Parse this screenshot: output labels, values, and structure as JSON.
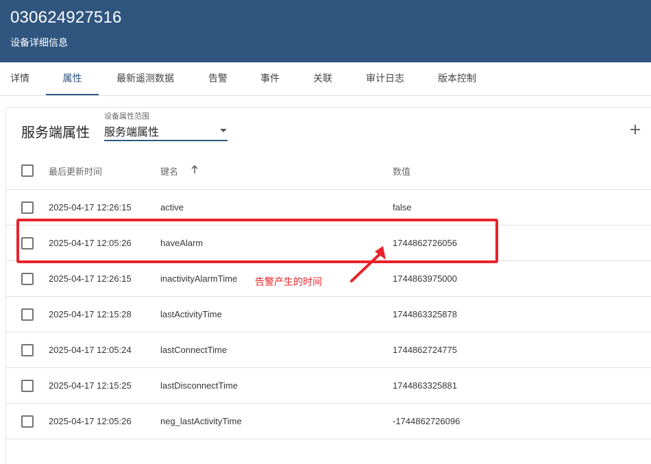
{
  "header": {
    "title": "030624927516",
    "subtitle": "设备详细信息"
  },
  "tabs": [
    {
      "label": "详情",
      "active": false
    },
    {
      "label": "属性",
      "active": true
    },
    {
      "label": "最新遥测数据",
      "active": false
    },
    {
      "label": "告警",
      "active": false
    },
    {
      "label": "事件",
      "active": false
    },
    {
      "label": "关联",
      "active": false
    },
    {
      "label": "审计日志",
      "active": false
    },
    {
      "label": "版本控制",
      "active": false
    }
  ],
  "panel": {
    "title": "服务端属性",
    "scope_label": "设备属性范围",
    "scope_value": "服务端属性"
  },
  "table": {
    "columns": {
      "updated": "最后更新时间",
      "key": "键名",
      "value": "数值"
    },
    "rows": [
      {
        "updated": "2025-04-17 12:26:15",
        "key": "active",
        "value": "false"
      },
      {
        "updated": "2025-04-17 12:05:26",
        "key": "haveAlarm",
        "value": "1744862726056"
      },
      {
        "updated": "2025-04-17 12:26:15",
        "key": "inactivityAlarmTime",
        "value": "1744863975000"
      },
      {
        "updated": "2025-04-17 12:15:28",
        "key": "lastActivityTime",
        "value": "1744863325878"
      },
      {
        "updated": "2025-04-17 12:05:24",
        "key": "lastConnectTime",
        "value": "1744862724775"
      },
      {
        "updated": "2025-04-17 12:15:25",
        "key": "lastDisconnectTime",
        "value": "1744863325881"
      },
      {
        "updated": "2025-04-17 12:05:26",
        "key": "neg_lastActivityTime",
        "value": "-1744862726096"
      }
    ]
  },
  "annotation": {
    "text": "告警产生的时间",
    "color": "#e8222a"
  },
  "colors": {
    "primary": "#305680",
    "annotation": "#e8222a"
  }
}
